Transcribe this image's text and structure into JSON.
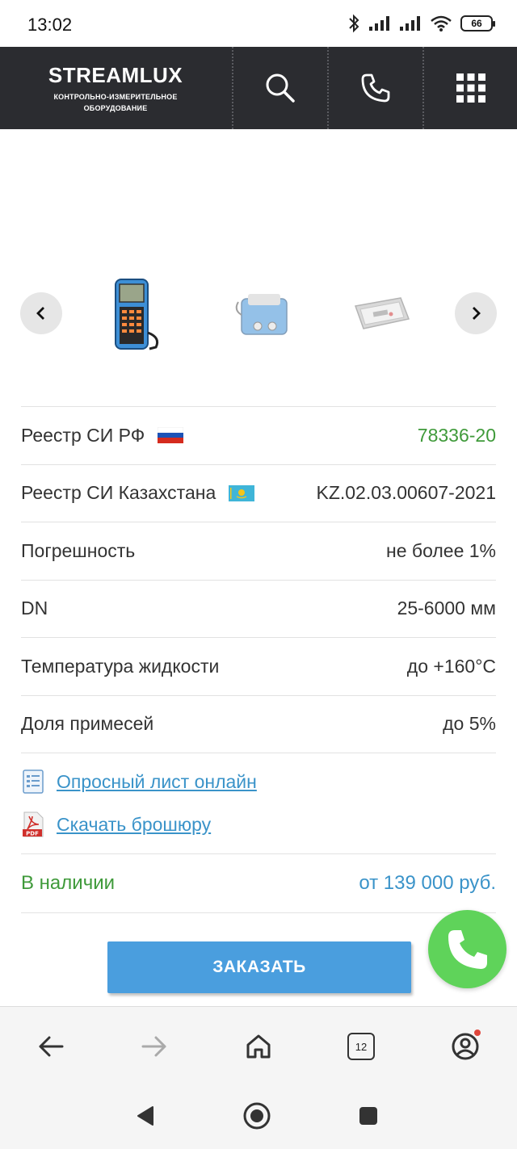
{
  "status_bar": {
    "time": "13:02",
    "battery": "66",
    "icons": [
      "bluetooth-icon",
      "signal-icon",
      "signal-icon",
      "wifi-icon",
      "battery-icon"
    ]
  },
  "header": {
    "logo_name": "STREAMLUX",
    "logo_sub_1": "КОНТРОЛЬНО-ИЗМЕРИТЕЛЬНОЕ",
    "logo_sub_2": "ОБОРУДОВАНИЕ",
    "icons": [
      "search-icon",
      "phone-icon",
      "grid-menu-icon"
    ],
    "bg_color": "#2b2c30"
  },
  "gallery": {
    "thumbnails": [
      "handheld-flowmeter",
      "flowmeter-device",
      "carry-case"
    ]
  },
  "specs": [
    {
      "label": "Реестр СИ РФ",
      "value": "78336-20",
      "flag": "russia"
    },
    {
      "label": "Реестр СИ Казахстана",
      "value": "KZ.02.03.00607-2021",
      "flag": "kazakhstan"
    },
    {
      "label": "Погрешность",
      "value": "не более 1%"
    },
    {
      "label": "DN",
      "value": "25-6000 мм"
    },
    {
      "label": "Температура жидкости",
      "value": "до +160°C"
    },
    {
      "label": "Доля примесей",
      "value": "до 5%"
    }
  ],
  "links": {
    "questionnaire": "Опросный лист онлайн",
    "brochure": "Скачать брошюру",
    "pdf_icon_label": "PDF"
  },
  "availability": {
    "status": "В наличии",
    "price": "от 139 000 руб."
  },
  "order_button": "ЗАКАЗАТЬ",
  "browser_nav": {
    "tabs_count": "12"
  },
  "colors": {
    "green": "#3f9a3a",
    "blue_link": "#3a93c9",
    "button": "#4a9ede",
    "call_fab": "#5fd35a"
  }
}
